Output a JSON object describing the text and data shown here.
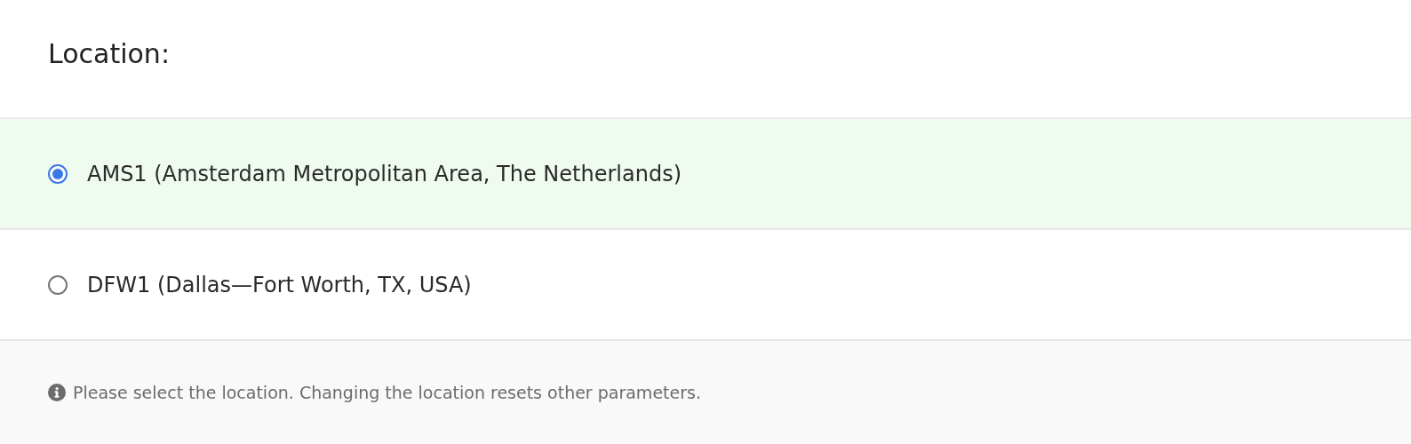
{
  "title": "Location:",
  "options": [
    {
      "label": "AMS1 (Amsterdam Metropolitan Area, The Netherlands)",
      "selected": true
    },
    {
      "label": "DFW1 (Dallas—Fort Worth, TX, USA)",
      "selected": false
    }
  ],
  "hint": "Please select the location. Changing the location resets other parameters."
}
